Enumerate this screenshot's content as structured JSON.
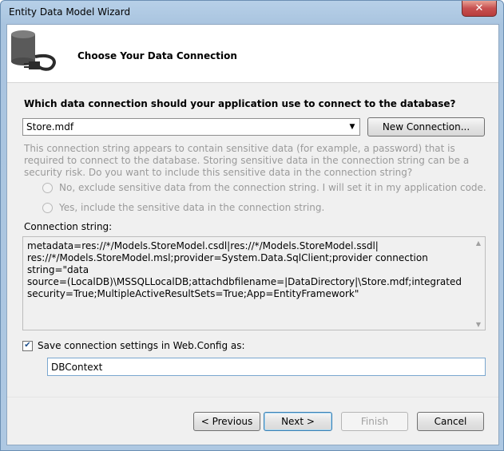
{
  "window": {
    "title": "Entity Data Model Wizard",
    "close_glyph": "✕"
  },
  "header": {
    "title": "Choose Your Data Connection",
    "icon": "database-connection-icon"
  },
  "connection": {
    "question": "Which data connection should your application use to connect to the database?",
    "selected": "Store.mdf",
    "new_connection_label": "New Connection...",
    "sensitive_description": "This connection string appears to contain sensitive data (for example, a password) that is required to connect to the database. Storing sensitive data in the connection string can be a security risk. Do you want to include this sensitive data in the connection string?",
    "option_exclude": "No, exclude sensitive data from the connection string. I will set it in my application code.",
    "option_include": "Yes, include the sensitive data in the connection string.",
    "string_label": "Connection string:",
    "string_value": "metadata=res://*/Models.StoreModel.csdl|res://*/Models.StoreModel.ssdl|\nres://*/Models.StoreModel.msl;provider=System.Data.SqlClient;provider connection string=\"data\nsource=(LocalDB)\\MSSQLLocalDB;attachdbfilename=|DataDirectory|\\Store.mdf;integrated\nsecurity=True;MultipleActiveResultSets=True;App=EntityFramework\""
  },
  "save": {
    "checked": true,
    "label": "Save connection settings in Web.Config as:",
    "name_value": "DBContext"
  },
  "buttons": {
    "previous": "< Previous",
    "next": "Next >",
    "finish": "Finish",
    "cancel": "Cancel"
  },
  "colors": {
    "title_gradient": "#b7d0e8",
    "close_red": "#c75050",
    "disabled_text": "#9a9a9a"
  }
}
